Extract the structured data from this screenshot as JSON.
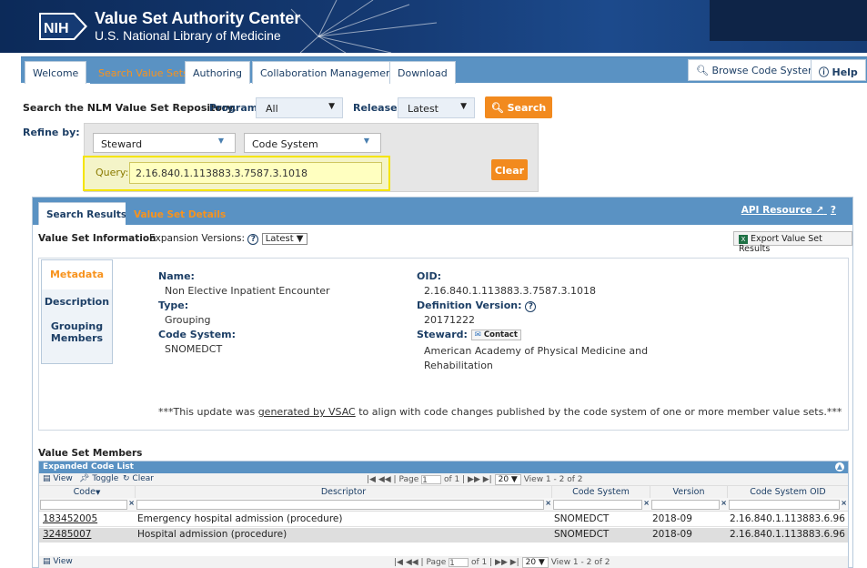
{
  "header": {
    "logo": "NIH",
    "title": "Value Set Authority Center",
    "subtitle": "U.S. National Library of Medicine"
  },
  "nav": {
    "tabs": [
      "Welcome",
      "Search Value Sets",
      "Authoring",
      "Collaboration Management",
      "Download"
    ],
    "browse": "Browse Code Systems",
    "help": "Help"
  },
  "search": {
    "intro": "Search the NLM Value Set Repository.",
    "program_label": "Program:",
    "program_value": "All",
    "release_label": "Release:",
    "release_value": "Latest",
    "search_button": "Search",
    "refine_label": "Refine by:",
    "steward_value": "Steward",
    "codesystem_value": "Code System",
    "query_label": "Query:",
    "query_value": "2.16.840.1.113883.3.7587.3.1018",
    "clear_button": "Clear"
  },
  "panel": {
    "tabs": [
      "Search Results",
      "Value Set Details"
    ],
    "api_resource": "API Resource",
    "vs_info": "Value Set Information",
    "expansion_label": "Expansion Versions:",
    "expansion_value": "Latest",
    "export_button": "Export Value Set Results"
  },
  "metadata": {
    "tabs": [
      "Metadata",
      "Description",
      "Grouping",
      "Members"
    ],
    "name_label": "Name:",
    "name_value": "Non Elective Inpatient Encounter",
    "type_label": "Type:",
    "type_value": "Grouping",
    "codesystem_label": "Code System:",
    "codesystem_value": "SNOMEDCT",
    "oid_label": "OID:",
    "oid_value": "2.16.840.1.113883.3.7587.3.1018",
    "defver_label": "Definition Version:",
    "defver_value": "20171222",
    "steward_label": "Steward:",
    "contact": "Contact",
    "steward_line1": "American Academy of Physical Medicine and",
    "steward_line2": "Rehabilitation",
    "note_pre": "***This update was ",
    "note_link": "generated by VSAC",
    "note_post": " to align with code changes published by the code system of one or more member value sets.***"
  },
  "members": {
    "title": "Value Set Members",
    "caption": "Expanded Code List",
    "tools": {
      "view": "View",
      "toggle": "Toggle",
      "clear": "Clear"
    },
    "pager": {
      "page_label": "Page",
      "page_value": "1",
      "of": "of 1",
      "rows": "20",
      "view": "View 1 - 2 of 2"
    },
    "columns": [
      "Code",
      "Descriptor",
      "Code System",
      "Version",
      "Code System OID"
    ],
    "rows": [
      {
        "code": "183452005",
        "descriptor": "Emergency hospital admission (procedure)",
        "system": "SNOMEDCT",
        "version": "2018-09",
        "oid": "2.16.840.1.113883.6.96"
      },
      {
        "code": "32485007",
        "descriptor": "Hospital admission (procedure)",
        "system": "SNOMEDCT",
        "version": "2018-09",
        "oid": "2.16.840.1.113883.6.96"
      }
    ]
  },
  "colors": {
    "navy": "#153a73",
    "nav_blue": "#5a92c3",
    "orange": "#f28a1e",
    "query_highlight": "#f5e400"
  }
}
